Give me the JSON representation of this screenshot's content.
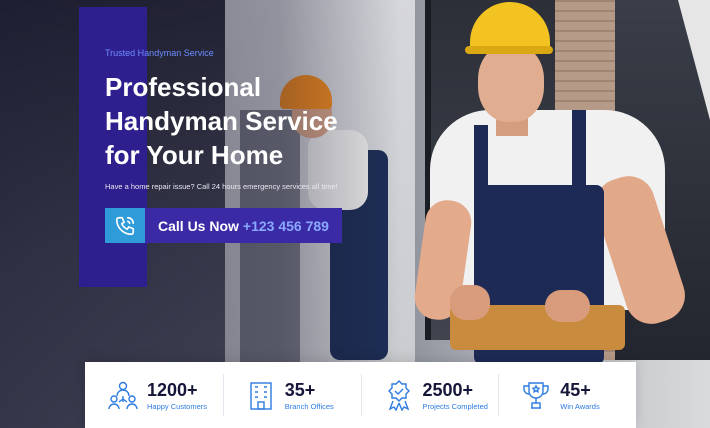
{
  "hero": {
    "eyebrow": "Trusted Handyman Service",
    "title": "Professional\nHandyman Service\nfor Your Home",
    "description": "Have a home repair issue? Call 24 hours emergency services all time!"
  },
  "cta": {
    "label": "Call Us Now",
    "phone": "+123 456 789",
    "icon": "phone-icon"
  },
  "colors": {
    "accent": "#2e1f8e",
    "cta_bg": "#3b2aa5",
    "icon_bg": "#2f9bd9",
    "stat_label": "#2d7be0",
    "eyebrow": "#6d8cff"
  },
  "stats": [
    {
      "value": "1200+",
      "label": "Happy Customers",
      "icon": "customers-icon"
    },
    {
      "value": "35+",
      "label": "Branch Offices",
      "icon": "building-icon"
    },
    {
      "value": "2500+",
      "label": "Projects Completed",
      "icon": "badge-icon"
    },
    {
      "value": "45+",
      "label": "Win Awards",
      "icon": "trophy-icon"
    }
  ]
}
